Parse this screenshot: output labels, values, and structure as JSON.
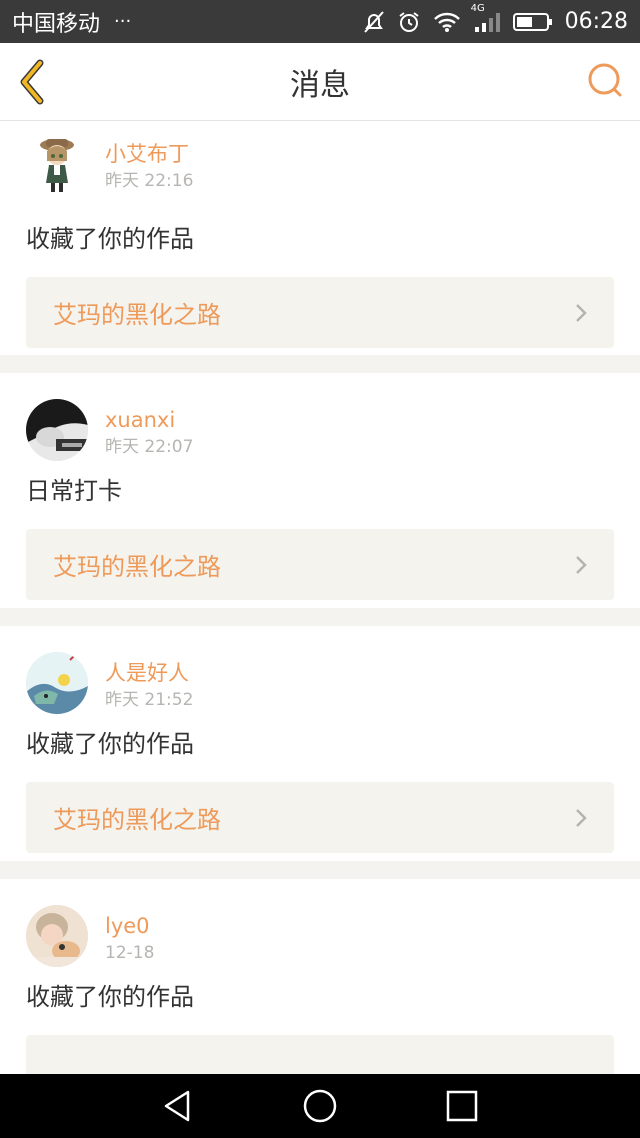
{
  "status_bar": {
    "carrier": "中国移动",
    "dots": "···",
    "network": "4G",
    "time": "06:28",
    "icons": [
      "mute-icon",
      "alarm-icon",
      "wifi-icon",
      "signal-icon",
      "battery-icon"
    ]
  },
  "nav": {
    "title": "消息",
    "back_icon": "back-chevron-icon",
    "search_icon": "search-icon",
    "accent": "#ee9a5a",
    "back_color": "#f2b824"
  },
  "messages": [
    {
      "username": "小艾布丁",
      "time": "昨天 22:16",
      "action": "收藏了你的作品",
      "work": "艾玛的黑化之路"
    },
    {
      "username": "xuanxi",
      "time": "昨天 22:07",
      "action": "日常打卡",
      "work": "艾玛的黑化之路"
    },
    {
      "username": "人是好人",
      "time": "昨天 21:52",
      "action": "收藏了你的作品",
      "work": "艾玛的黑化之路"
    },
    {
      "username": "lye0",
      "time": "12-18",
      "action": "收藏了你的作品",
      "work": ""
    }
  ],
  "system_nav": [
    "back-triangle-icon",
    "home-circle-icon",
    "recent-square-icon"
  ]
}
